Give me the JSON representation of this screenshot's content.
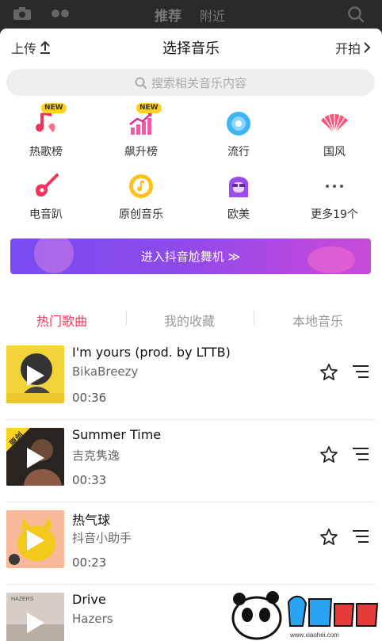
{
  "topbar": {
    "tab_recommend": "推荐",
    "tab_nearby": "附近"
  },
  "header": {
    "upload_label": "上传",
    "title": "选择音乐",
    "start_label": "开拍"
  },
  "search": {
    "placeholder": "搜索相关音乐内容"
  },
  "categories": [
    {
      "label": "热歌榜",
      "icon": "music-note-icon",
      "badge": "NEW"
    },
    {
      "label": "飙升榜",
      "icon": "rising-chart-icon",
      "badge": "NEW"
    },
    {
      "label": "流行",
      "icon": "disc-icon"
    },
    {
      "label": "国风",
      "icon": "folding-fan-icon"
    },
    {
      "label": "电音趴",
      "icon": "electric-guitar-icon"
    },
    {
      "label": "原创音乐",
      "icon": "original-music-icon"
    },
    {
      "label": "欧美",
      "icon": "western-girl-icon"
    },
    {
      "label": "更多19个",
      "icon": "more-dots-icon"
    }
  ],
  "banner": {
    "label": "进入抖音尬舞机 ≫"
  },
  "tabs": [
    "热门歌曲",
    "我的收藏",
    "本地音乐"
  ],
  "songs": [
    {
      "title": "I'm yours (prod. by LTTB)",
      "artist": "BikaBreezy",
      "duration": "00:36"
    },
    {
      "title": "Summer Time",
      "artist": "吉克隽逸",
      "duration": "00:33",
      "cover_tag": "原创"
    },
    {
      "title": "热气球",
      "artist": "抖音小助手",
      "duration": "00:23"
    },
    {
      "title": "Drive",
      "artist": "Hazers",
      "duration": ""
    }
  ],
  "colors": {
    "accent": "#f2345c",
    "banner_start": "#7a4cf2",
    "banner_end": "#c94bd8"
  }
}
